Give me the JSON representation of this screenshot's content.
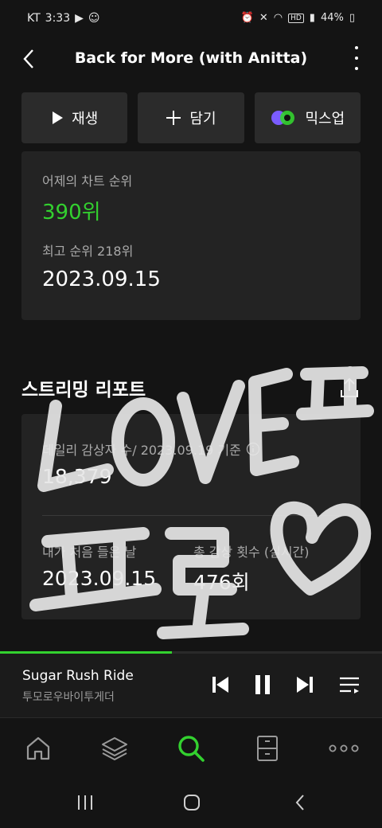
{
  "status_bar": {
    "carrier": "KT",
    "time": "3:33",
    "battery": "44%",
    "hd": "HD"
  },
  "header": {
    "title": "Back for More (with Anitta)"
  },
  "actions": {
    "play": "재생",
    "add": "담기",
    "mixup": "믹스업"
  },
  "chart": {
    "yesterday_label": "어제의 차트 순위",
    "yesterday_rank": "390위",
    "peak_label": "최고 순위 218위",
    "peak_date": "2023.09.15"
  },
  "streaming": {
    "title": "스트리밍 리포트",
    "daily_label": "데일리 감상자 수/ 2023.09.19 기준",
    "daily_value": "18,379",
    "first_listen_label": "내가 처음 들은 날",
    "first_listen_value": "2023.09.15",
    "total_label": "총 감상 횟수 (실시간)",
    "total_value": "476회"
  },
  "player": {
    "song": "Sugar Rush Ride",
    "artist": "투모로우바이투게더",
    "progress": 0.45
  },
  "handwriting": {
    "text": "LOVE 프 프로"
  },
  "colors": {
    "accent": "#33d12f",
    "background": "#141414",
    "card": "#232323"
  },
  "icons": [
    "back-icon",
    "more-icon",
    "play-icon",
    "plus-icon",
    "mixup-icon",
    "info-icon",
    "share-icon",
    "previous-icon",
    "pause-icon",
    "next-icon",
    "playlist-icon",
    "home-icon",
    "layers-icon",
    "search-icon",
    "storage-icon",
    "more-dots-icon",
    "recents-icon",
    "home-circle-icon",
    "back-arrow-icon"
  ]
}
